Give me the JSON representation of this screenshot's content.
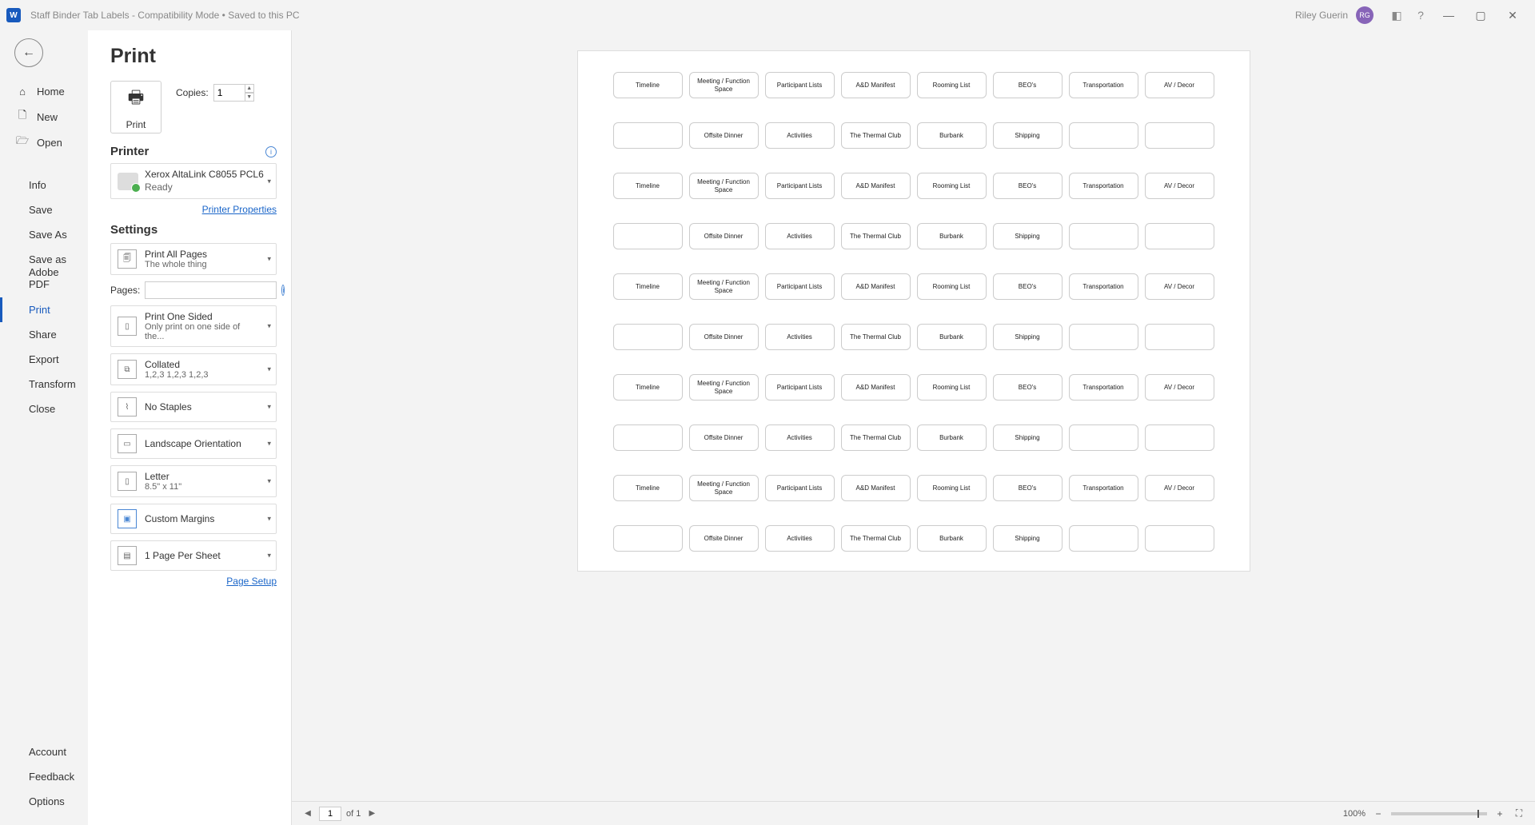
{
  "titlebar": {
    "app_initial": "W",
    "doc_title": "Staff Binder Tab Labels  -  Compatibility Mode • Saved to this PC",
    "user_name": "Riley Guerin",
    "user_initials": "RG"
  },
  "nav": {
    "home": "Home",
    "new": "New",
    "open": "Open",
    "info": "Info",
    "save": "Save",
    "save_as": "Save As",
    "save_pdf": "Save as Adobe PDF",
    "print": "Print",
    "share": "Share",
    "export": "Export",
    "transform": "Transform",
    "close": "Close",
    "account": "Account",
    "feedback": "Feedback",
    "options": "Options"
  },
  "panel": {
    "title": "Print",
    "print_button": "Print",
    "copies_label": "Copies:",
    "copies_value": "1",
    "printer_heading": "Printer",
    "printer_name": "Xerox AltaLink C8055 PCL6",
    "printer_status": "Ready",
    "printer_properties": "Printer Properties",
    "settings_heading": "Settings",
    "pages_label": "Pages:",
    "page_setup": "Page Setup",
    "settings": {
      "print_all": {
        "t1": "Print All Pages",
        "t2": "The whole thing"
      },
      "one_sided": {
        "t1": "Print One Sided",
        "t2": "Only print on one side of the..."
      },
      "collated": {
        "t1": "Collated",
        "t2": "1,2,3    1,2,3    1,2,3"
      },
      "staples": {
        "t1": "No Staples",
        "t2": ""
      },
      "orientation": {
        "t1": "Landscape Orientation",
        "t2": ""
      },
      "paper": {
        "t1": "Letter",
        "t2": "8.5\" x 11\""
      },
      "margins": {
        "t1": "Custom Margins",
        "t2": ""
      },
      "pps": {
        "t1": "1 Page Per Sheet",
        "t2": ""
      }
    }
  },
  "preview": {
    "row_a": [
      "Timeline",
      "Meeting / Function Space",
      "Participant Lists",
      "A&D Manifest",
      "Rooming List",
      "BEO's",
      "Transportation",
      "AV / Decor"
    ],
    "row_b": [
      "",
      "Offsite Dinner",
      "Activities",
      "The Thermal Club",
      "Burbank",
      "Shipping",
      "",
      ""
    ]
  },
  "status": {
    "page_current": "1",
    "page_of": "of 1",
    "zoom": "100%"
  }
}
